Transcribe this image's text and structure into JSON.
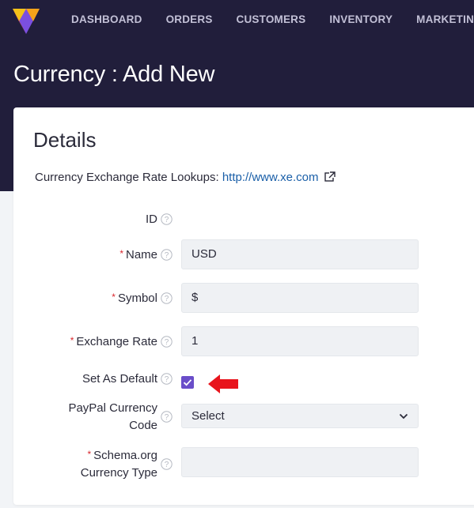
{
  "nav": {
    "items": [
      "DASHBOARD",
      "ORDERS",
      "CUSTOMERS",
      "INVENTORY",
      "MARKETING"
    ]
  },
  "page": {
    "title": "Currency : Add New"
  },
  "card": {
    "title": "Details",
    "lookup_text": "Currency Exchange Rate Lookups:",
    "lookup_link": "http://www.xe.com"
  },
  "form": {
    "id_label": "ID",
    "name_label": "Name",
    "name_value": "USD",
    "symbol_label": "Symbol",
    "symbol_value": "$",
    "rate_label": "Exchange Rate",
    "rate_value": "1",
    "default_label": "Set As Default",
    "default_checked": true,
    "paypal_label_line1": "PayPal Currency",
    "paypal_label_line2": "Code",
    "paypal_value": "Select",
    "schema_label_line1": "Schema.org",
    "schema_label_line2": "Currency Type",
    "schema_value": "",
    "required_marker": "*"
  },
  "colors": {
    "header_bg": "#211e3b",
    "accent": "#6a4ec9",
    "required": "#d9262c",
    "link": "#1a5fa8",
    "annotation_arrow": "#e8141c"
  },
  "icons": [
    "logo-icon",
    "help-icon",
    "external-link-icon",
    "chevron-down-icon",
    "checkmark-icon",
    "arrow-left-icon"
  ]
}
